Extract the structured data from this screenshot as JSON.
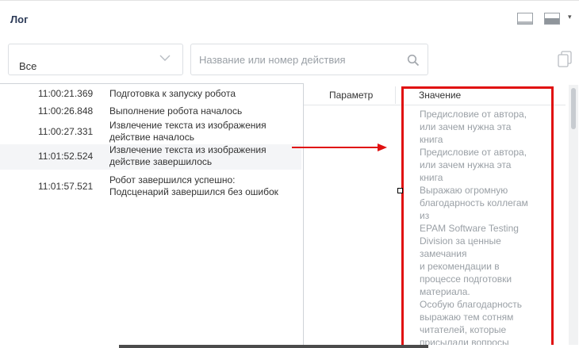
{
  "header": {
    "title": "Лог"
  },
  "toolbar": {
    "filter_value": "Все",
    "search_placeholder": "Название или номер действия"
  },
  "log": {
    "rows": [
      {
        "time": "11:00:21.369",
        "line1": "Подготовка к запуску робота",
        "line2": ""
      },
      {
        "time": "11:00:26.848",
        "line1": "Выполнение робота началось",
        "line2": ""
      },
      {
        "time": "11:00:27.331",
        "line1": "Извлечение текста из изображения",
        "line2": "действие началось"
      },
      {
        "time": "11:01:52.524",
        "line1": "Извлечение текста из изображения",
        "line2": "действие завершилось"
      },
      {
        "time": "11:01:57.521",
        "line1": "Робот завершился успешно:",
        "line2": "Подсценарий завершился без ошибок"
      }
    ]
  },
  "table": {
    "col_param": "Параметр",
    "col_value": "Значение",
    "value_lines": [
      "Предисловие от автора,",
      "или зачем нужна эта",
      "книга",
      "Предисловие от автора,",
      "или зачем нужна эта",
      "книга",
      "Выражаю огромную",
      "благодарность коллегам",
      "из",
      "EPAM Software Testing",
      "Division за ценные",
      "замечания",
      "и рекомендации в",
      "процессе подготовки",
      "материала.",
      "Особую благодарность",
      "выражаю тем сотням",
      "читателей, которые",
      "присылали вопросы"
    ]
  },
  "colors": {
    "annotation": "#e01010",
    "muted_text": "#9aa0a6",
    "title": "#2b3a57"
  }
}
